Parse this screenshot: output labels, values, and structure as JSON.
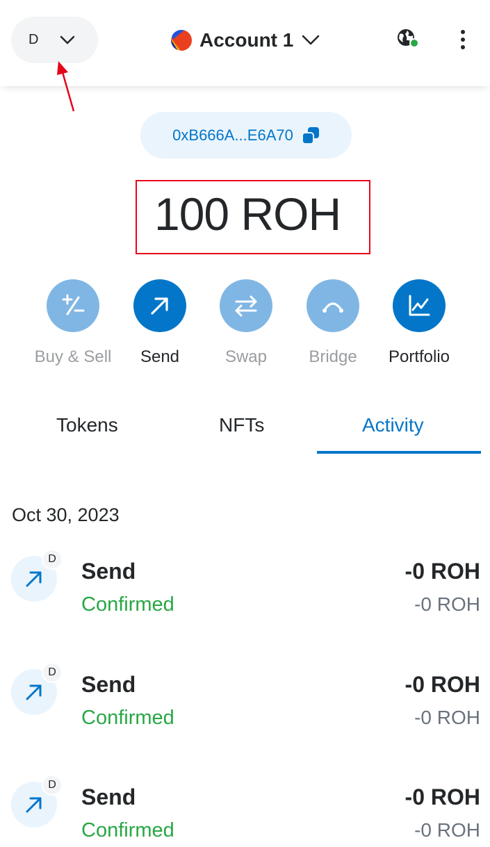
{
  "header": {
    "network_letter": "D",
    "account_name": "Account 1"
  },
  "address": {
    "short": "0xB666A...E6A70"
  },
  "balance": {
    "value": "100",
    "unit": "ROH"
  },
  "actions": [
    {
      "label": "Buy & Sell",
      "icon": "plus-minus-icon",
      "state": "muted"
    },
    {
      "label": "Send",
      "icon": "arrow-up-right-icon",
      "state": "active"
    },
    {
      "label": "Swap",
      "icon": "swap-arrows-icon",
      "state": "muted"
    },
    {
      "label": "Bridge",
      "icon": "bridge-icon",
      "state": "muted"
    },
    {
      "label": "Portfolio",
      "icon": "chart-icon",
      "state": "active"
    }
  ],
  "tabs": [
    {
      "label": "Tokens"
    },
    {
      "label": "NFTs"
    },
    {
      "label": "Activity",
      "active": true
    }
  ],
  "activity": {
    "date": "Oct 30, 2023",
    "items": [
      {
        "badge": "D",
        "title": "Send",
        "status": "Confirmed",
        "amount": "-0 ROH",
        "fiat": "-0 ROH"
      },
      {
        "badge": "D",
        "title": "Send",
        "status": "Confirmed",
        "amount": "-0 ROH",
        "fiat": "-0 ROH"
      },
      {
        "badge": "D",
        "title": "Send",
        "status": "Confirmed",
        "amount": "-0 ROH",
        "fiat": "-0 ROH"
      }
    ]
  },
  "colors": {
    "primary": "#0376c9",
    "primary_muted": "#80b6e4",
    "success": "#28a745",
    "annotation_red": "#e4061b"
  }
}
